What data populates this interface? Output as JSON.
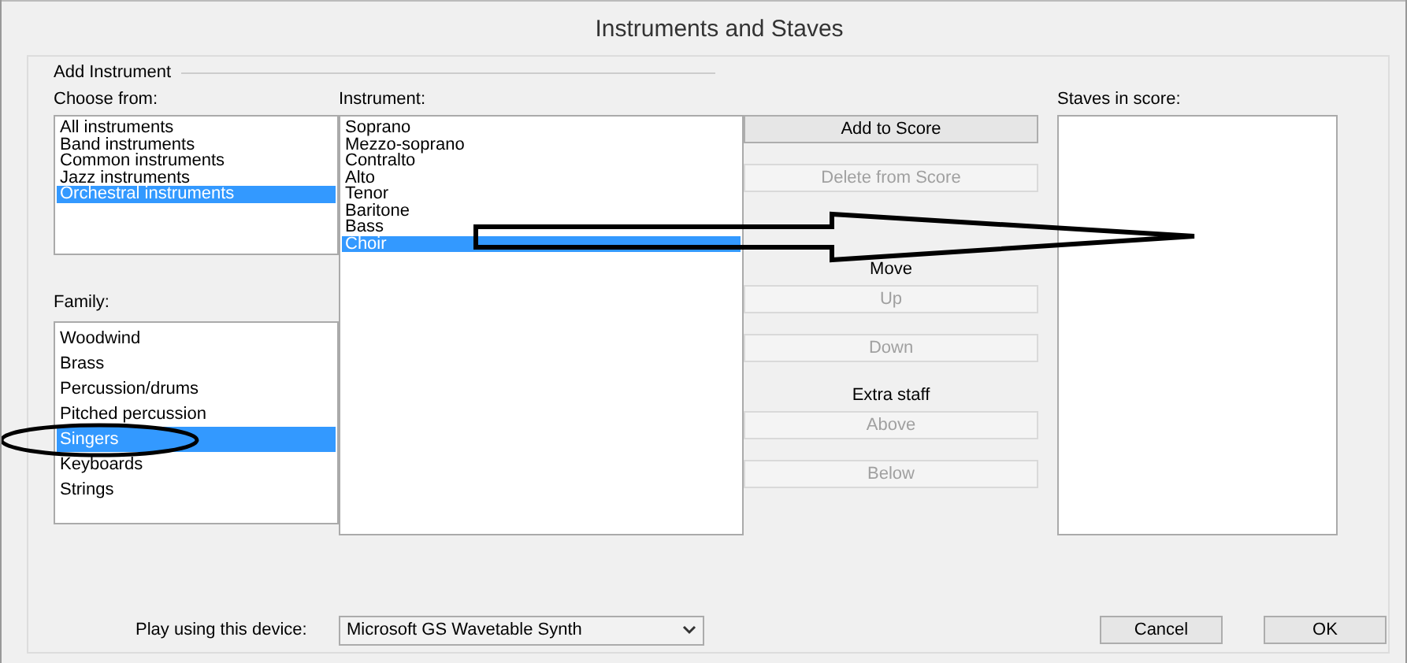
{
  "window": {
    "title": "Instruments and Staves"
  },
  "add_instrument": {
    "title": "Add Instrument",
    "choose_from": {
      "label": "Choose from:",
      "items": [
        {
          "text": "All instruments",
          "selected": false
        },
        {
          "text": "Band instruments",
          "selected": false
        },
        {
          "text": "Common instruments",
          "selected": false
        },
        {
          "text": "Jazz instruments",
          "selected": false
        },
        {
          "text": "Orchestral instruments",
          "selected": true
        }
      ]
    },
    "family": {
      "label": "Family:",
      "items": [
        {
          "text": "Woodwind",
          "selected": false
        },
        {
          "text": "Brass",
          "selected": false
        },
        {
          "text": "Percussion/drums",
          "selected": false
        },
        {
          "text": "Pitched percussion",
          "selected": false
        },
        {
          "text": "Singers",
          "selected": true
        },
        {
          "text": "Keyboards",
          "selected": false
        },
        {
          "text": "Strings",
          "selected": false
        }
      ]
    },
    "instrument": {
      "label": "Instrument:",
      "items": [
        {
          "text": "Soprano",
          "selected": false
        },
        {
          "text": "Mezzo-soprano",
          "selected": false
        },
        {
          "text": "Contralto",
          "selected": false
        },
        {
          "text": "Alto",
          "selected": false
        },
        {
          "text": "Tenor",
          "selected": false
        },
        {
          "text": "Baritone",
          "selected": false
        },
        {
          "text": "Bass",
          "selected": false
        },
        {
          "text": "Choir",
          "selected": true
        }
      ]
    }
  },
  "actions": [
    {
      "kind": "button",
      "text": "Add to Score",
      "disabled": false
    },
    {
      "kind": "button",
      "text": "Delete from Score",
      "disabled": true
    },
    {
      "kind": "heading",
      "text": "Move"
    },
    {
      "kind": "button",
      "text": "Up",
      "disabled": true
    },
    {
      "kind": "button",
      "text": "Down",
      "disabled": true
    },
    {
      "kind": "heading",
      "text": "Extra staff"
    },
    {
      "kind": "button",
      "text": "Above",
      "disabled": true
    },
    {
      "kind": "button",
      "text": "Below",
      "disabled": true
    }
  ],
  "staves": {
    "label": "Staves in score:"
  },
  "device": {
    "label": "Play using this device:",
    "value": "Microsoft GS Wavetable Synth"
  },
  "buttons": [
    {
      "text": "Cancel"
    },
    {
      "text": "OK"
    }
  ]
}
